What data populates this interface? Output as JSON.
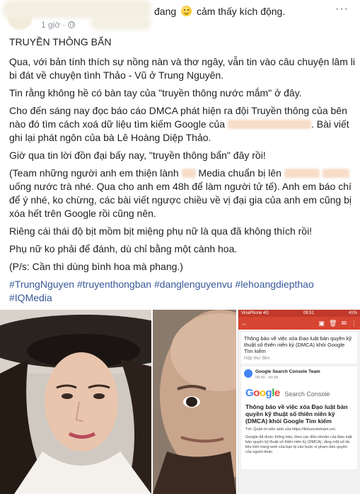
{
  "header": {
    "status_prefix": "đang",
    "status_feeling": "cảm thấy kích động.",
    "timestamp": "1 giờ ·",
    "more_label": "···"
  },
  "post": {
    "title": "TRUYỀN THÔNG BẨN",
    "p1": "Qua, với bản tính thích sự nồng nàn và thơ ngây, vẫn tin vào câu chuyện lâm li bi đát về chuyện tình Thảo - Vũ ở Trung Nguyên.",
    "p2": "Tin rằng không hề có bàn tay của \"truyền thông nước mắm\" ở đây.",
    "p3_a": "Cho đến sáng nay đọc báo cáo DMCA phát hiện ra đội Truyền thông của bên nào đó tìm cách xoá dữ liệu tìm kiếm Google của",
    "p3_b": ". Bài viết ghi lại phát ngôn của bà Lê Hoàng Diệp Thảo.",
    "p4": "Giờ qua tin lời đồn đại bấy nay, \"truyền thông bẩn\" đây rồi!",
    "p5_a": "(Team những người anh em thiện lành",
    "p5_b": "Media chuẩn bị lên",
    "p5_c": "uống nước trà nhé. Qua cho anh em 48h để làm người tử tế). Anh em báo chí để ý nhé, ko chừng, các bài viết ngược chiều về vị đại gia của anh em cũng bị xóa hết trên Google rồi cũng nên.",
    "p6": "Riêng cái thái độ bịt mồm bịt miệng phụ nữ là qua đã không thích rồi!",
    "p7": "Phụ nữ ko phải để đánh, dù chỉ bằng một cành hoa.",
    "p8": "(P/s: Cần thì dùng bình hoa mà phang.)",
    "hashtags": [
      "#TrungNguyen",
      "#truyenthongban",
      "#danglenguyenvu",
      "#lehoangdiepthao",
      "#IQMedia"
    ]
  },
  "phone": {
    "carrier": "VinaPhone 4G",
    "time": "08:51",
    "battery": "41%",
    "subject": "Thông báo về việc xóa Đạo luật bản quyền kỹ thuật số thiên niên kỷ (DMCA) khỏi Google Tìm kiếm",
    "folder": "Hộp thư đến",
    "sender_name": "Google Search Console Team",
    "sender_time": "08:45",
    "sender_to": "tới tôi",
    "logo_letters": [
      {
        "ch": "G",
        "color": "#4285f4"
      },
      {
        "ch": "o",
        "color": "#ea4335"
      },
      {
        "ch": "o",
        "color": "#fbbc05"
      },
      {
        "ch": "g",
        "color": "#4285f4"
      },
      {
        "ch": "l",
        "color": "#34a853"
      },
      {
        "ch": "e",
        "color": "#ea4335"
      }
    ],
    "product": "Search Console",
    "heading": "Thông báo về việc xóa Đạo luật bản quyền kỹ thuật số thiên niên kỷ (DMCA) khỏi Google Tìm kiếm",
    "to_line": "Tới: Quản trị viên web của https://tinluocvietnam.vn/,",
    "body_small": "Google đã được thông báo, theo các điều khoản của Đạo luật bản quyền kỹ thuật số thiên niên kỷ (DMCA), rằng một số tài liệu trên trang web của bạn bị cáo buộc vi phạm bản quyền của người khác."
  }
}
